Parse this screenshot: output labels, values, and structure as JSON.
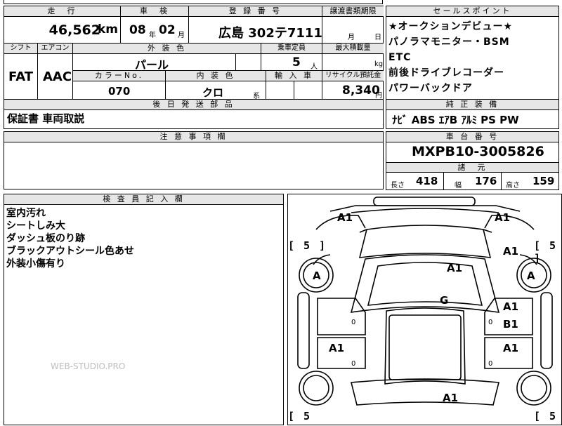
{
  "top": {
    "mileage_label": "走　行",
    "mileage_value": "46,562",
    "mileage_unit": "km",
    "inspection_label": "車　検",
    "inspection_year": "08",
    "inspection_year_unit": "年",
    "inspection_month": "02",
    "inspection_month_unit": "月",
    "registration_label": "登 録 番 号",
    "registration_value": "広島  302テ7111",
    "transfer_label": "譲渡書類期限",
    "transfer_month": "月",
    "transfer_day": "日"
  },
  "row2": {
    "shift_label": "シフト",
    "shift_value": "FAT",
    "ac_label": "エアコン",
    "ac_value": "AAC",
    "exterior_label": "外 装 色",
    "exterior_value": "パール",
    "capacity_label": "乗車定員",
    "capacity_value": "5",
    "capacity_unit": "人",
    "maxload_label": "最大積載量",
    "maxload_unit": "kg",
    "color_no_label": "カラーNo.",
    "color_no_value": "070",
    "interior_label": "内 装 色",
    "interior_value": "クロ",
    "interior_unit": "系",
    "import_label": "輸 入 車",
    "recycle_label": "リサイクル預託金",
    "recycle_value": "8,340",
    "recycle_unit": "円"
  },
  "later": {
    "label": "後 日 発 送 部 品",
    "value": "保証書 車両取説"
  },
  "caution": {
    "label": "注 意 事 項 欄"
  },
  "sales_point": {
    "label": "セールスポイント",
    "items": [
      "★オークションデビュー★",
      "パノラマモニター・BSM",
      "ETC",
      "前後ドライブレコーダー",
      "パワーバックドア"
    ]
  },
  "equipment": {
    "label": "純 正 装 備",
    "value": "ﾅﾋﾞ  ABS  ｴｱB  ｱﾙﾐ  PS  PW"
  },
  "chassis": {
    "label": "車 台 番 号",
    "value": "MXPB10-3005826"
  },
  "dimensions": {
    "label": "諸　元",
    "length_label": "長さ",
    "length_value": "418",
    "width_label": "幅",
    "width_value": "176",
    "height_label": "高さ",
    "height_value": "159"
  },
  "inspector": {
    "label": "検 査 員 記 入 欄",
    "notes": [
      "室内汚れ",
      "シートしみ大",
      "ダッシュ板のり跡",
      "ブラックアウトシール色あせ",
      "外装小傷有り"
    ]
  },
  "watermark": "WEB-STUDIO.PRO",
  "diagram": {
    "marks": [
      "A1",
      "A1",
      "A1",
      "A1",
      "A",
      "A",
      "G",
      "A1",
      "B1",
      "A1",
      "A1",
      "A1"
    ],
    "brackets": [
      "[ 5 ]",
      "[ 5 ]",
      "[ 5",
      "[ 5"
    ],
    "small": [
      "0",
      "0",
      "0",
      "0"
    ]
  }
}
